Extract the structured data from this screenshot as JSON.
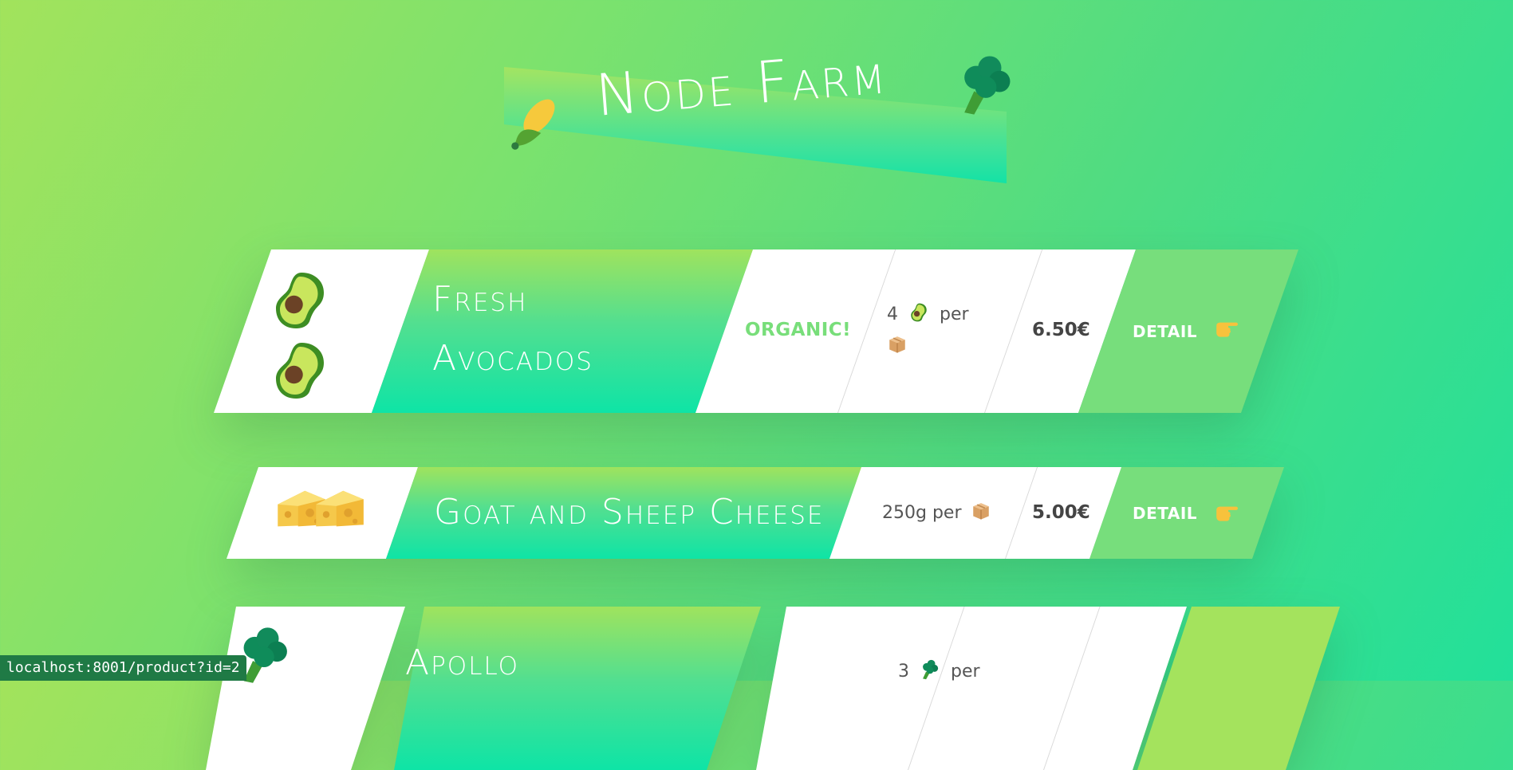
{
  "header": {
    "title": "Node Farm",
    "corn_icon": "corn-icon",
    "broccoli_icon": "broccoli-icon"
  },
  "products": [
    {
      "name_line1": "Fresh",
      "name_line2": "Avocados",
      "organic_label": "ORGANIC!",
      "quantity_prefix": "4",
      "quantity_per": "per",
      "price": "6.50€",
      "detail_label": "DETAIL",
      "icon": "avocado-icon"
    },
    {
      "name": "Goat and Sheep Cheese",
      "quantity": "250g per",
      "price": "5.00€",
      "detail_label": "DETAIL",
      "icon": "cheese-icon"
    },
    {
      "name_line1": "Apollo",
      "quantity_prefix": "3",
      "quantity_per": "per",
      "icon": "broccoli-icon"
    }
  ],
  "status_bar": {
    "url": "localhost:8001/product?id=2"
  },
  "colors": {
    "accent_green": "#77de7c",
    "gradient_top": "#a2e35c",
    "gradient_bottom": "#22e09a",
    "text_dark": "#444444"
  }
}
